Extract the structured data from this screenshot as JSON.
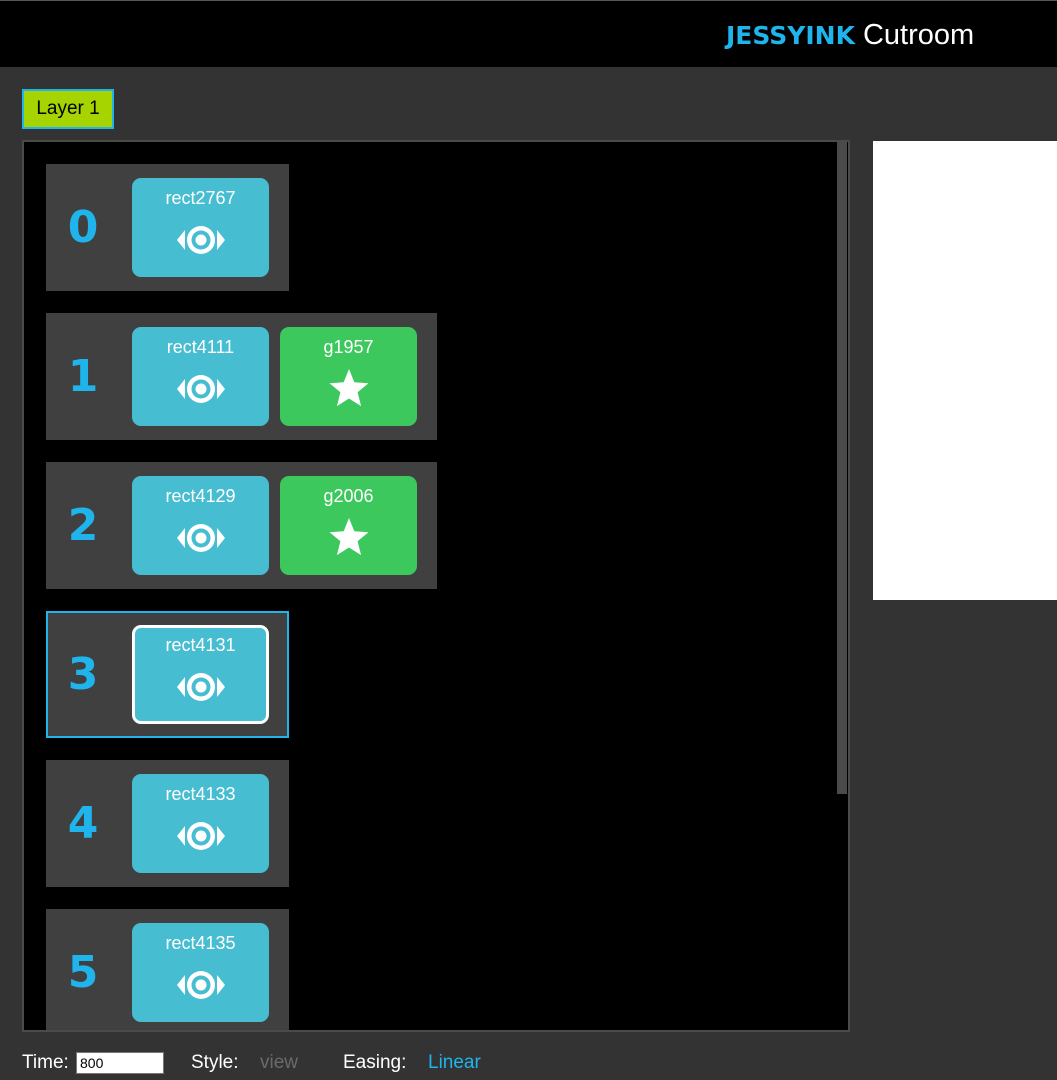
{
  "header": {
    "brand_primary": "JESSYINK",
    "brand_secondary": "Cutroom"
  },
  "layer_tab": {
    "label": "Layer 1"
  },
  "slides": [
    {
      "number": "0",
      "cards": [
        {
          "label": "rect2767",
          "icon": "eye-icon",
          "type": "view"
        }
      ]
    },
    {
      "number": "1",
      "cards": [
        {
          "label": "rect4111",
          "icon": "eye-icon",
          "type": "view"
        },
        {
          "label": "g1957",
          "icon": "star-icon",
          "type": "effect"
        }
      ]
    },
    {
      "number": "2",
      "cards": [
        {
          "label": "rect4129",
          "icon": "eye-icon",
          "type": "view"
        },
        {
          "label": "g2006",
          "icon": "star-icon",
          "type": "effect"
        }
      ]
    },
    {
      "number": "3",
      "selected": true,
      "cards": [
        {
          "label": "rect4131",
          "icon": "eye-icon",
          "type": "view",
          "active": true
        }
      ]
    },
    {
      "number": "4",
      "cards": [
        {
          "label": "rect4133",
          "icon": "eye-icon",
          "type": "view"
        }
      ]
    },
    {
      "number": "5",
      "cards": [
        {
          "label": "rect4135",
          "icon": "eye-icon",
          "type": "view"
        }
      ]
    }
  ],
  "footer": {
    "time_label": "Time:",
    "time_value": "800",
    "style_label": "Style:",
    "style_value": "view",
    "easing_label": "Easing:",
    "easing_value": "Linear"
  },
  "colors": {
    "accent": "#1fb5ec",
    "view_card": "#47bdd2",
    "effect_card": "#3cc85d",
    "layer_tab": "#a6d400"
  }
}
